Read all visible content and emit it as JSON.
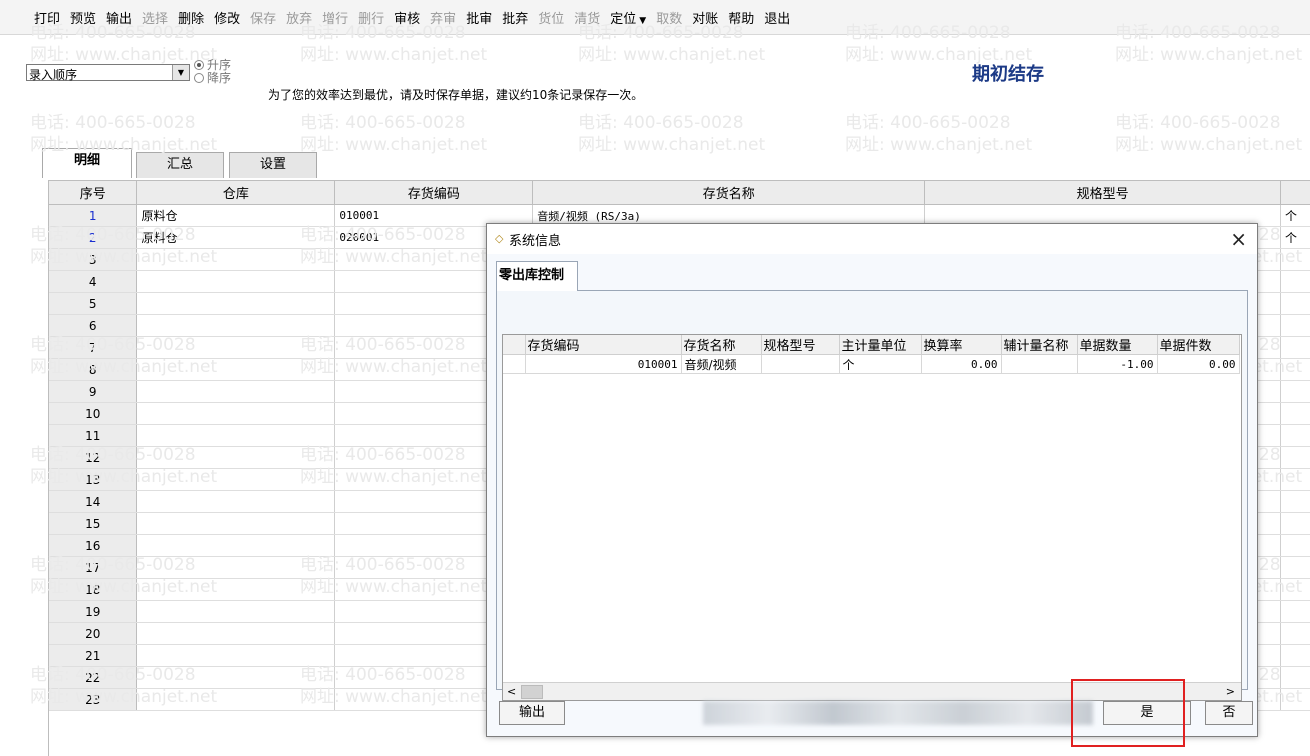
{
  "toolbar": {
    "items": [
      {
        "label": "打印",
        "disabled": false
      },
      {
        "label": "预览",
        "disabled": false
      },
      {
        "label": "输出",
        "disabled": false
      },
      {
        "label": "选择",
        "disabled": true
      },
      {
        "label": "删除",
        "disabled": false
      },
      {
        "label": "修改",
        "disabled": false
      },
      {
        "label": "保存",
        "disabled": true
      },
      {
        "label": "放弃",
        "disabled": true
      },
      {
        "label": "增行",
        "disabled": true
      },
      {
        "label": "删行",
        "disabled": true
      },
      {
        "label": "审核",
        "disabled": false
      },
      {
        "label": "弃审",
        "disabled": true
      },
      {
        "label": "批审",
        "disabled": false
      },
      {
        "label": "批弃",
        "disabled": false
      },
      {
        "label": "货位",
        "disabled": true
      },
      {
        "label": "清货",
        "disabled": true
      },
      {
        "label": "定位",
        "disabled": false
      },
      {
        "label": "取数",
        "disabled": true
      },
      {
        "label": "对账",
        "disabled": false
      },
      {
        "label": "帮助",
        "disabled": false
      },
      {
        "label": "退出",
        "disabled": false
      }
    ]
  },
  "sort": {
    "selected": "录入顺序",
    "asc_label": "升序",
    "desc_label": "降序"
  },
  "tip": "为了您的效率达到最优，请及时保存单据，建议约10条记录保存一次。",
  "page_title": "期初结存",
  "tabs": [
    "明细",
    "汇总",
    "设置"
  ],
  "grid": {
    "columns": [
      "序号",
      "仓库",
      "存货编码",
      "存货名称",
      "规格型号"
    ],
    "rows": [
      {
        "no": "1",
        "warehouse": "原料仓",
        "code": "010001",
        "name": "音频/视频 (RS/3a)",
        "unit": "个"
      },
      {
        "no": "2",
        "warehouse": "原料仓",
        "code": "020001",
        "name": "",
        "unit": "个"
      },
      {
        "no": "3"
      },
      {
        "no": "4"
      },
      {
        "no": "5"
      },
      {
        "no": "6"
      },
      {
        "no": "7"
      },
      {
        "no": "8"
      },
      {
        "no": "9"
      },
      {
        "no": "10"
      },
      {
        "no": "11"
      },
      {
        "no": "12"
      },
      {
        "no": "13"
      },
      {
        "no": "14"
      },
      {
        "no": "15"
      },
      {
        "no": "16"
      },
      {
        "no": "17"
      },
      {
        "no": "18"
      },
      {
        "no": "19"
      },
      {
        "no": "20"
      },
      {
        "no": "21"
      },
      {
        "no": "22"
      },
      {
        "no": "23"
      }
    ]
  },
  "watermark": {
    "phone": "电话: 400-665-0028",
    "site": "网址: www.chanjet.net"
  },
  "dialog": {
    "title": "系统信息",
    "tab": "零出库控制",
    "columns": [
      "存货编码",
      "存货名称",
      "规格型号",
      "主计量单位",
      "换算率",
      "辅计量名称",
      "单据数量",
      "单据件数"
    ],
    "rows": [
      {
        "code": "010001",
        "name": "音频/视频",
        "spec": "",
        "unit": "个",
        "rate": "0.00",
        "aux": "",
        "qty": "-1.00",
        "pieces": "0.00"
      }
    ],
    "export_label": "输出",
    "confirm_label": "是",
    "no_label": "否",
    "close_glyph": "×"
  },
  "colors": {
    "title_blue": "#1c3a86",
    "row_no_blue": "#1a2fd0",
    "highlight_red": "#e02020"
  }
}
